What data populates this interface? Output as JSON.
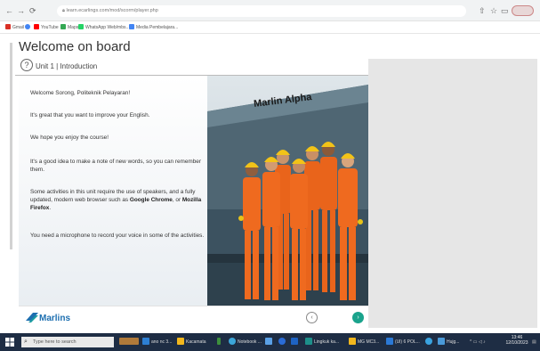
{
  "browser": {
    "url": "learn.ecarlings.com/mod/scorm/player.php",
    "bookmarks": [
      "Gmail",
      "YouTube",
      "Maps",
      "WhatsApp Web/mbs..",
      "Media Pembelajara..."
    ],
    "colors": {
      "gmail": "#d93025",
      "youtube": "#ff0000",
      "maps": "#34a853",
      "whatsapp": "#25d366",
      "google": "#4285f4"
    }
  },
  "page": {
    "title": "Welcome on board",
    "subtitle": "Unit 1 | Introduction",
    "help_icon": "?"
  },
  "lesson": {
    "paragraphs": [
      [
        "Welcome Sorong, Politeknik Pelayaran!"
      ],
      [
        "It's great that you want to improve your English."
      ],
      [
        "We hope you enjoy the course!"
      ],
      [
        "It's a good idea to make a note of new words, so you can remember them."
      ],
      [
        "Some activities in this unit require the use of speakers, and a fully updated, modern web browser such as ",
        "Google Chrome",
        ", or ",
        "Mozilla Firefox",
        "."
      ],
      [
        "You need a microphone to record your voice in some of the activities."
      ]
    ],
    "ship_name": "Marlin Alpha"
  },
  "footer": {
    "brand": "Marlins",
    "prev_icon": "‹",
    "next_icon": "›",
    "colors": {
      "brand": "#1d6fb0",
      "next": "#1aa38c"
    }
  },
  "taskbar": {
    "search_placeholder": "Type here to search",
    "apps": [
      "ano nc 3...",
      "Kacamata",
      "Notebook ...",
      "Lingkuk ka...",
      "MG MC3...",
      "(Ul) 6 POL...",
      "Hujg..."
    ],
    "time": "13:46",
    "date": "12/10/2023"
  }
}
